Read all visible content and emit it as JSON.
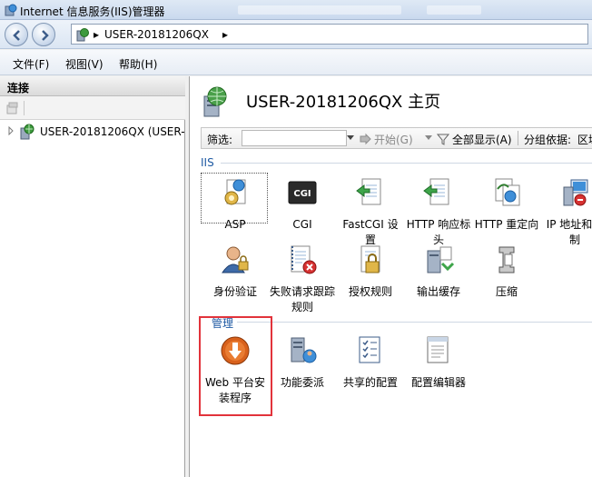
{
  "window": {
    "title": "Internet 信息服务(IIS)管理器"
  },
  "address": {
    "crumb": "USER-20181206QX",
    "arrow": "▸"
  },
  "menu": {
    "file": "文件(F)",
    "view": "视图(V)",
    "help": "帮助(H)"
  },
  "connections": {
    "header": "连接",
    "tree_item": "USER-20181206QX (USER-"
  },
  "main": {
    "title": "USER-20181206QX 主页",
    "filter": {
      "label": "筛选:",
      "go": "开始(G)",
      "show_all": "全部显示(A)",
      "group_by": "分组依据:",
      "group_value": "区域"
    },
    "groups": {
      "iis": {
        "label": "IIS",
        "items": [
          {
            "label": "ASP",
            "icon": "asp-icon"
          },
          {
            "label": "CGI",
            "icon": "cgi-icon"
          },
          {
            "label": "FastCGI 设置",
            "icon": "fastcgi-icon"
          },
          {
            "label": "HTTP 响应标头",
            "icon": "http-headers-icon"
          },
          {
            "label": "HTTP 重定向",
            "icon": "http-redirect-icon"
          },
          {
            "label": "IP 地址和限制",
            "icon": "ip-restrict-icon"
          },
          {
            "label": "身份验证",
            "icon": "authentication-icon"
          },
          {
            "label": "失败请求跟踪规则",
            "icon": "failed-request-icon"
          },
          {
            "label": "授权规则",
            "icon": "authorization-icon"
          },
          {
            "label": "输出缓存",
            "icon": "output-cache-icon"
          },
          {
            "label": "压缩",
            "icon": "compression-icon"
          }
        ]
      },
      "management": {
        "label": "管理",
        "items": [
          {
            "label": "Web 平台安装程序",
            "icon": "web-platform-installer-icon"
          },
          {
            "label": "功能委派",
            "icon": "feature-delegation-icon"
          },
          {
            "label": "共享的配置",
            "icon": "shared-config-icon"
          },
          {
            "label": "配置编辑器",
            "icon": "config-editor-icon"
          }
        ]
      }
    }
  },
  "colors": {
    "highlight": "#e2333b",
    "group_label": "#1f5aa3",
    "installer_orange": "#d8611c"
  }
}
